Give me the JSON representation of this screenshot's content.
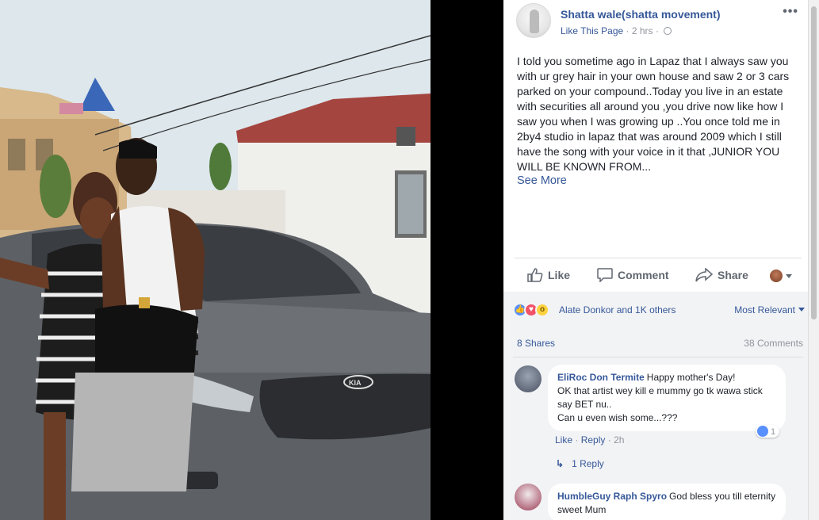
{
  "post": {
    "page_name": "Shatta wale(shatta movement)",
    "like_page": "Like This Page",
    "separator": "·",
    "time": "2 hrs",
    "time_sep": "·",
    "more": "•••",
    "body": "I told you sometime ago in Lapaz that I always saw you with ur grey hair in your own house and saw 2 or 3 cars parked on your compound..Today you live in an estate with securities all around you ,you drive now like how I saw you when I was growing up ..You once told me in 2by4 studio in lapaz that was around 2009 which I still have the song with your voice in it that ,JUNIOR YOU WILL BE KNOWN FROM...",
    "see_more": "See More"
  },
  "actions": {
    "like": "Like",
    "comment": "Comment",
    "share": "Share"
  },
  "feedback": {
    "reactors": "Alate Donkor and 1K others",
    "sort": "Most Relevant",
    "shares": "8 Shares",
    "comments_count": "38 Comments"
  },
  "comments": [
    {
      "author": "EliRoc Don Termite",
      "text_line1": "Happy mother's Day!",
      "text_rest": "OK that artist wey kill e mummy go tk wawa stick say BET nu..",
      "text_last": "Can u even wish some...???",
      "like": "Like",
      "reply": "Reply",
      "dot": "·",
      "time": "2h",
      "reactions": "1",
      "replies": "1 Reply"
    },
    {
      "author": "HumbleGuy Raph Spyro",
      "text": "God bless you till eternity sweet Mum"
    }
  ],
  "icons": {
    "like": "thumbs-up-icon",
    "comment": "speech-bubble-icon",
    "share": "share-arrow-icon",
    "globe": "globe-icon",
    "reply": "reply-arrow-icon"
  },
  "colors": {
    "link": "#365899",
    "muted": "#90949c",
    "like_blue": "#5890ff",
    "love_red": "#f25268",
    "wow_yellow": "#fcd240"
  }
}
